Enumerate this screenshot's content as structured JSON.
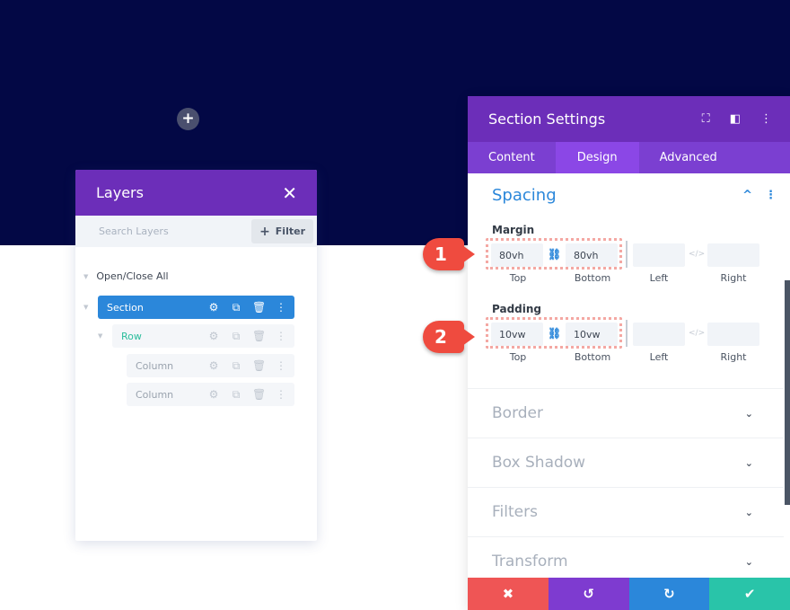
{
  "canvas": {
    "hero_color": "#030845",
    "add_icon": "plus-icon"
  },
  "layers": {
    "title": "Layers",
    "close_icon": "✕",
    "search_placeholder": "Search Layers",
    "filter_label": "Filter",
    "filter_icon": "+",
    "open_close_all": "Open/Close All",
    "items": [
      {
        "label": "Section",
        "level": 0,
        "selected": true
      },
      {
        "label": "Row",
        "level": 1,
        "selected": false
      },
      {
        "label": "Column",
        "level": 2,
        "selected": false
      },
      {
        "label": "Column",
        "level": 2,
        "selected": false
      }
    ],
    "item_actions": [
      "gear-icon",
      "duplicate-icon",
      "trash-icon",
      "more-icon"
    ]
  },
  "settings": {
    "title": "Section Settings",
    "header_icons": [
      "expand-icon",
      "sidebar-icon",
      "more-icon"
    ],
    "tabs": [
      {
        "label": "Content",
        "active": false
      },
      {
        "label": "Design",
        "active": true
      },
      {
        "label": "Advanced",
        "active": false
      }
    ],
    "spacing": {
      "title": "Spacing",
      "margin": {
        "label": "Margin",
        "top": "80vh",
        "bottom": "80vh",
        "left": "",
        "right": "",
        "sub_top": "Top",
        "sub_bottom": "Bottom",
        "sub_left": "Left",
        "sub_right": "Right"
      },
      "padding": {
        "label": "Padding",
        "top": "10vw",
        "bottom": "10vw",
        "left": "",
        "right": "",
        "sub_top": "Top",
        "sub_bottom": "Bottom",
        "sub_left": "Left",
        "sub_right": "Right"
      }
    },
    "sections": [
      "Border",
      "Box Shadow",
      "Filters",
      "Transform"
    ],
    "actions": {
      "cancel": "✖",
      "undo": "↺",
      "redo": "↻",
      "save": "✔"
    },
    "colors": {
      "cancel": "#ef5555",
      "undo": "#7e3bd0",
      "redo": "#2b87da",
      "save": "#29c4a9",
      "accent": "#6c2eb9"
    }
  },
  "annotations": {
    "badge1": "1",
    "badge2": "2"
  }
}
